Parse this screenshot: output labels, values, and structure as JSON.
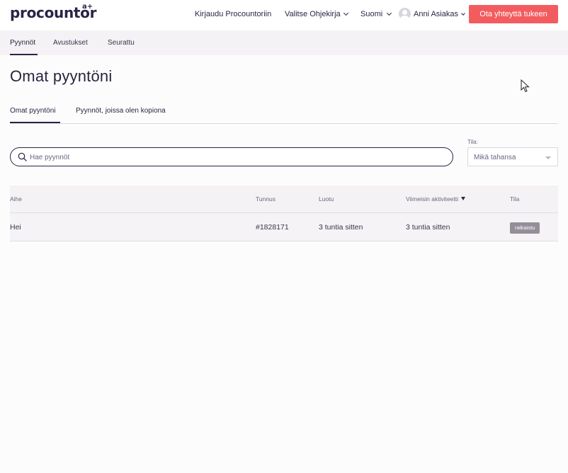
{
  "header": {
    "logo": "procountor",
    "logo_sup": "a+",
    "nav": {
      "login": "Kirjaudu Procountoriin",
      "guide": "Valitse Ohjekirja",
      "language": "Suomi",
      "user": "Anni Asiakas"
    },
    "cta": "Ota yhteyttä tukeen",
    "cta_color": "#f35c5f"
  },
  "subnav": {
    "items": [
      "Pyynnöt",
      "Avustukset",
      "Seurattu"
    ]
  },
  "page": {
    "title": "Omat pyyntöni"
  },
  "tabs": [
    "Omat pyyntöni",
    "Pyynnöt, joissa olen kopiona"
  ],
  "search": {
    "placeholder": "Hae pyynnöt"
  },
  "status_filter": {
    "label": "Tila:",
    "value": "Mikä tahansa"
  },
  "table": {
    "columns": [
      "Aihe",
      "Tunnus",
      "Luotu",
      "Viimeisin aktiviteetti",
      "Tila"
    ],
    "rows": [
      {
        "subject": "Hei",
        "id": "#1828171",
        "created": "3 tuntia sitten",
        "last_activity": "3 tuntia sitten",
        "status": "ratkaistu"
      }
    ]
  }
}
